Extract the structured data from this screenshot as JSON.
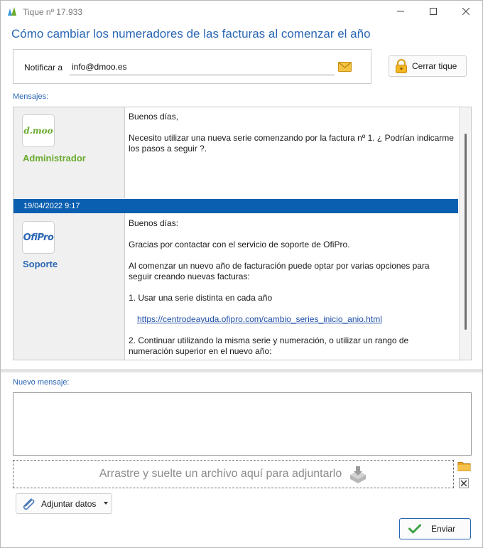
{
  "window": {
    "title": "Tique nº 17.933"
  },
  "ticket": {
    "subject": "Cómo cambiar los numeradores de las facturas al comenzar el año"
  },
  "notify": {
    "label": "Notificar a",
    "email": "info@dmoo.es"
  },
  "buttons": {
    "close_ticket": "Cerrar tique",
    "attach_data": "Adjuntar datos",
    "send": "Enviar"
  },
  "messages": {
    "label": "Mensajes:",
    "items": [
      {
        "author": "Administrador",
        "avatar_text": "d.moo",
        "body": [
          "Buenos días,",
          "Necesito utilizar una nueva serie comenzando por la factura nº 1. ¿ Podrían indicarme los pasos a seguir ?."
        ]
      },
      {
        "date": "19/04/2022 9:17",
        "author": "Soporte",
        "avatar_text": "OfiPro",
        "body": [
          "Buenos días:",
          "Gracias por contactar con el servicio de soporte de OfiPro.",
          "Al comenzar un nuevo año de facturación puede optar por varias opciones para seguir creando nuevas facturas:",
          "1. Usar una serie distinta en cada año",
          "2. Continuar utilizando la misma serie y numeración, o utilizar un rango de numeración superior en el nuevo año:"
        ],
        "link": "https://centrodeayuda.ofipro.com/cambio_series_inicio_anio.html"
      }
    ]
  },
  "new_message": {
    "label": "Nuevo mensaje:",
    "value": ""
  },
  "dropzone": {
    "text": "Arrastre y suelte un archivo aquí para adjuntarlo"
  },
  "colors": {
    "accent": "#2a66b4",
    "date_bar": "#0a5fb0",
    "admin_green": "#6aab2e"
  }
}
